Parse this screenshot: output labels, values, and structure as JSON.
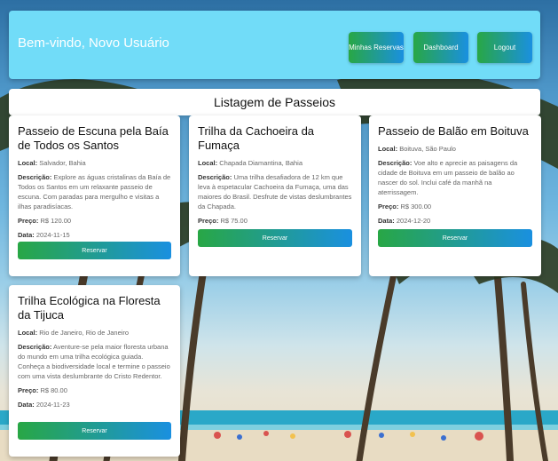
{
  "header": {
    "welcome": "Bem-vindo, Novo Usuário",
    "buttons": [
      "Minhas Reservas",
      "Dashboard",
      "Logout"
    ],
    "bg_color": "#71dcf8"
  },
  "listing_title": "Listagem de Passeios",
  "labels": {
    "local": "Local:",
    "descricao": "Descrição:",
    "preco": "Preço:",
    "data": "Data:",
    "reserve": "Reservar"
  },
  "tours": [
    {
      "title": "Passeio de Escuna pela Baía de Todos os Santos",
      "local": "Salvador, Bahia",
      "descricao": "Explore as águas cristalinas da Baía de Todos os Santos em um relaxante passeio de escuna. Com paradas para mergulho e visitas a ilhas paradisíacas.",
      "preco": "R$ 120.00",
      "data": "2024-11-15"
    },
    {
      "title": "Trilha da Cachoeira da Fumaça",
      "local": "Chapada Diamantina, Bahia",
      "descricao": "Uma trilha desafiadora de 12 km que leva à espetacular Cachoeira da Fumaça, uma das maiores do Brasil. Desfrute de vistas deslumbrantes da Chapada.",
      "preco": "R$ 75.00",
      "data": "2024-11-01"
    },
    {
      "title": "Passeio de Balão em Boituva",
      "local": "Boituva, São Paulo",
      "descricao": "Voe alto e aprecie as paisagens da cidade de Boituva em um passeio de balão ao nascer do sol. Inclui café da manhã na aterrissagem.",
      "preco": "R$ 300.00",
      "data": "2024-12-20"
    },
    {
      "title": "Trilha Ecológica na Floresta da Tijuca",
      "local": "Rio de Janeiro, Rio de Janeiro",
      "descricao": "Aventure-se pela maior floresta urbana do mundo em uma trilha ecológica guiada. Conheça a biodiversidade local e termine o passeio com uma vista deslumbrante do Cristo Redentor.",
      "preco": "R$ 80.00",
      "data": "2024-11-23"
    }
  ],
  "colors": {
    "button_gradient_start": "#28a745",
    "button_gradient_end": "#1a90e0"
  }
}
